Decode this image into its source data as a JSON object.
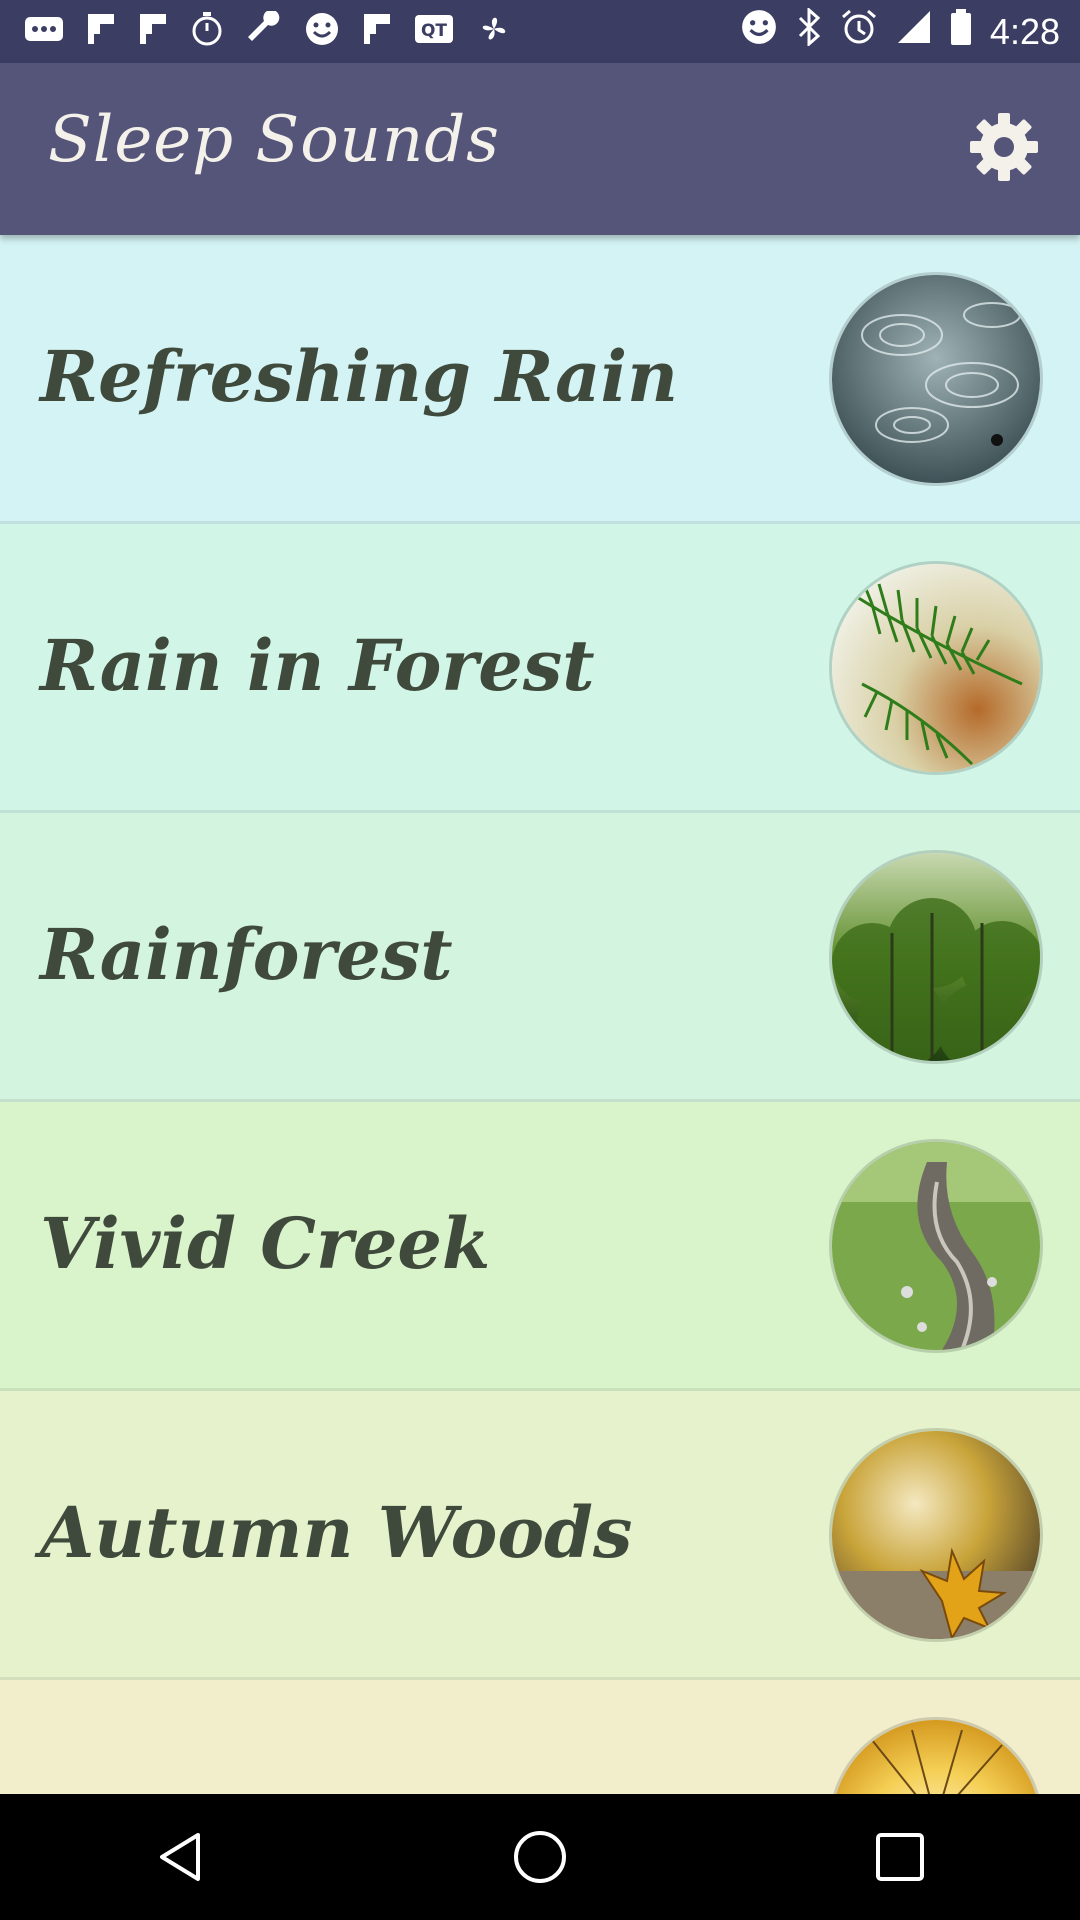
{
  "status_bar": {
    "time": "4:28",
    "left_icons": [
      "dots-icon",
      "flipboard-icon",
      "flipboard-icon",
      "timer-icon",
      "wrench-icon",
      "smiley-icon",
      "flipboard-icon",
      "qt-icon",
      "fan-icon"
    ],
    "right_icons": [
      "smiley-icon",
      "bluetooth-icon",
      "alarm-icon",
      "signal-icon",
      "battery-icon"
    ]
  },
  "app": {
    "title": "Sleep Sounds",
    "settings_icon": "gear-icon"
  },
  "sounds": [
    {
      "label": "Refreshing Rain",
      "bg": "#d4f3f4",
      "image": "rain-ripples"
    },
    {
      "label": "Rain in Forest",
      "bg": "#d1f6e7",
      "image": "pine-branch"
    },
    {
      "label": "Rainforest",
      "bg": "#d3f4de",
      "image": "forest"
    },
    {
      "label": "Vivid Creek",
      "bg": "#d9f4cb",
      "image": "creek"
    },
    {
      "label": "Autumn Woods",
      "bg": "#e6f2cc",
      "image": "autumn-leaf"
    },
    {
      "label": "",
      "bg": "#f2eecc",
      "image": "sunrise"
    }
  ],
  "colors": {
    "status_bar": "#3b3d63",
    "app_bar": "#555479",
    "row_text": "#3f4a3c"
  },
  "nav": [
    "back-icon",
    "home-icon",
    "recents-icon"
  ]
}
